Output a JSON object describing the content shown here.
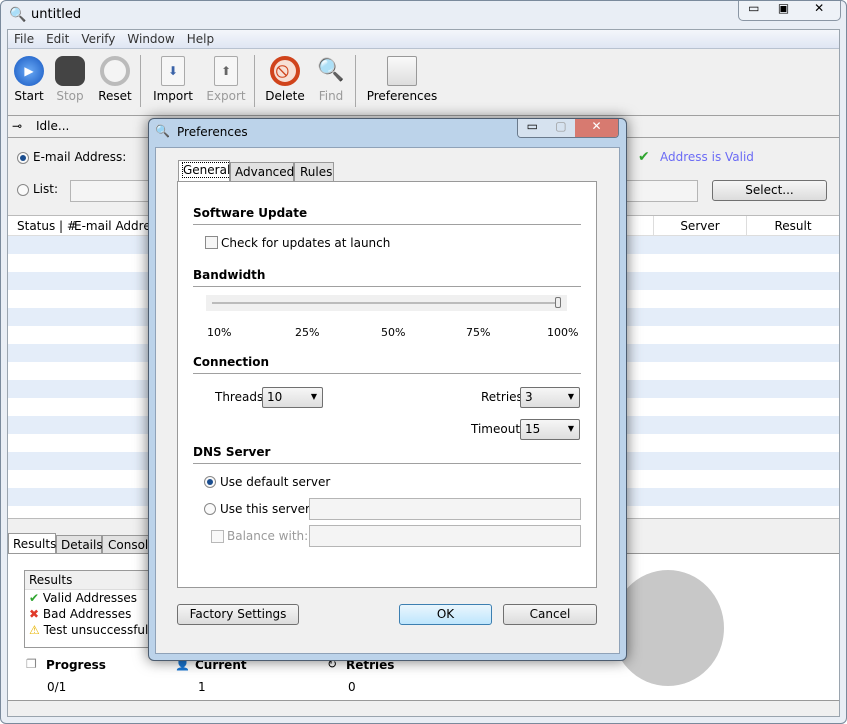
{
  "window": {
    "title": "untitled",
    "controls": [
      "minimize",
      "maximize",
      "close"
    ]
  },
  "menu": [
    "File",
    "Edit",
    "Verify",
    "Window",
    "Help"
  ],
  "toolbar": [
    {
      "label": "Start",
      "icon": "play-icon",
      "enabled": true
    },
    {
      "label": "Stop",
      "icon": "stop-icon",
      "enabled": false
    },
    {
      "label": "Reset",
      "icon": "reset-icon",
      "enabled": true
    },
    {
      "label": "Import",
      "icon": "import-icon",
      "enabled": true
    },
    {
      "label": "Export",
      "icon": "export-icon",
      "enabled": false
    },
    {
      "label": "Delete",
      "icon": "delete-icon",
      "enabled": true
    },
    {
      "label": "Find",
      "icon": "find-icon",
      "enabled": false
    },
    {
      "label": "Preferences",
      "icon": "preferences-icon",
      "enabled": true
    }
  ],
  "status": "Idle...",
  "input": {
    "email_label": "E-mail Address:",
    "list_label": "List:",
    "valid_text": "Address is Valid",
    "select_button": "Select..."
  },
  "table": {
    "columns": [
      "Status | #",
      "E-mail Address",
      "Server",
      "Result"
    ]
  },
  "bottom": {
    "tabs": [
      "Results",
      "Details",
      "Console"
    ],
    "results_header": "Results",
    "legend": [
      {
        "label": "Valid Addresses",
        "icon": "check-icon"
      },
      {
        "label": "Bad Addresses",
        "icon": "x-icon"
      },
      {
        "label": "Test unsuccessful",
        "icon": "warning-icon"
      }
    ],
    "stats": [
      {
        "label": "Progress",
        "value": "0/1"
      },
      {
        "label": "Current",
        "value": "1"
      },
      {
        "label": "Retries",
        "value": "0"
      }
    ]
  },
  "dialog": {
    "title": "Preferences",
    "tabs": [
      "General",
      "Advanced",
      "Rules"
    ],
    "active_tab": "General",
    "software_update": {
      "heading": "Software Update",
      "check_label": "Check for updates at launch",
      "checked": false
    },
    "bandwidth": {
      "heading": "Bandwidth",
      "ticks": [
        "10%",
        "25%",
        "50%",
        "75%",
        "100%"
      ],
      "value_percent": 100
    },
    "connection": {
      "heading": "Connection",
      "threads_label": "Threads:",
      "threads": "10",
      "retries_label": "Retries:",
      "retries": "3",
      "timeout_label": "Timeout:",
      "timeout": "15"
    },
    "dns": {
      "heading": "DNS Server",
      "default_label": "Use default server",
      "this_label": "Use this server:",
      "balance_label": "Balance with:",
      "selected": "default",
      "server_value": "",
      "balance_value": ""
    },
    "buttons": {
      "factory": "Factory Settings",
      "ok": "OK",
      "cancel": "Cancel"
    }
  },
  "colors": {
    "valid_text": "#6b6bf5",
    "row_stripe": "#e4edf9",
    "accent": "#3a7fd6"
  }
}
